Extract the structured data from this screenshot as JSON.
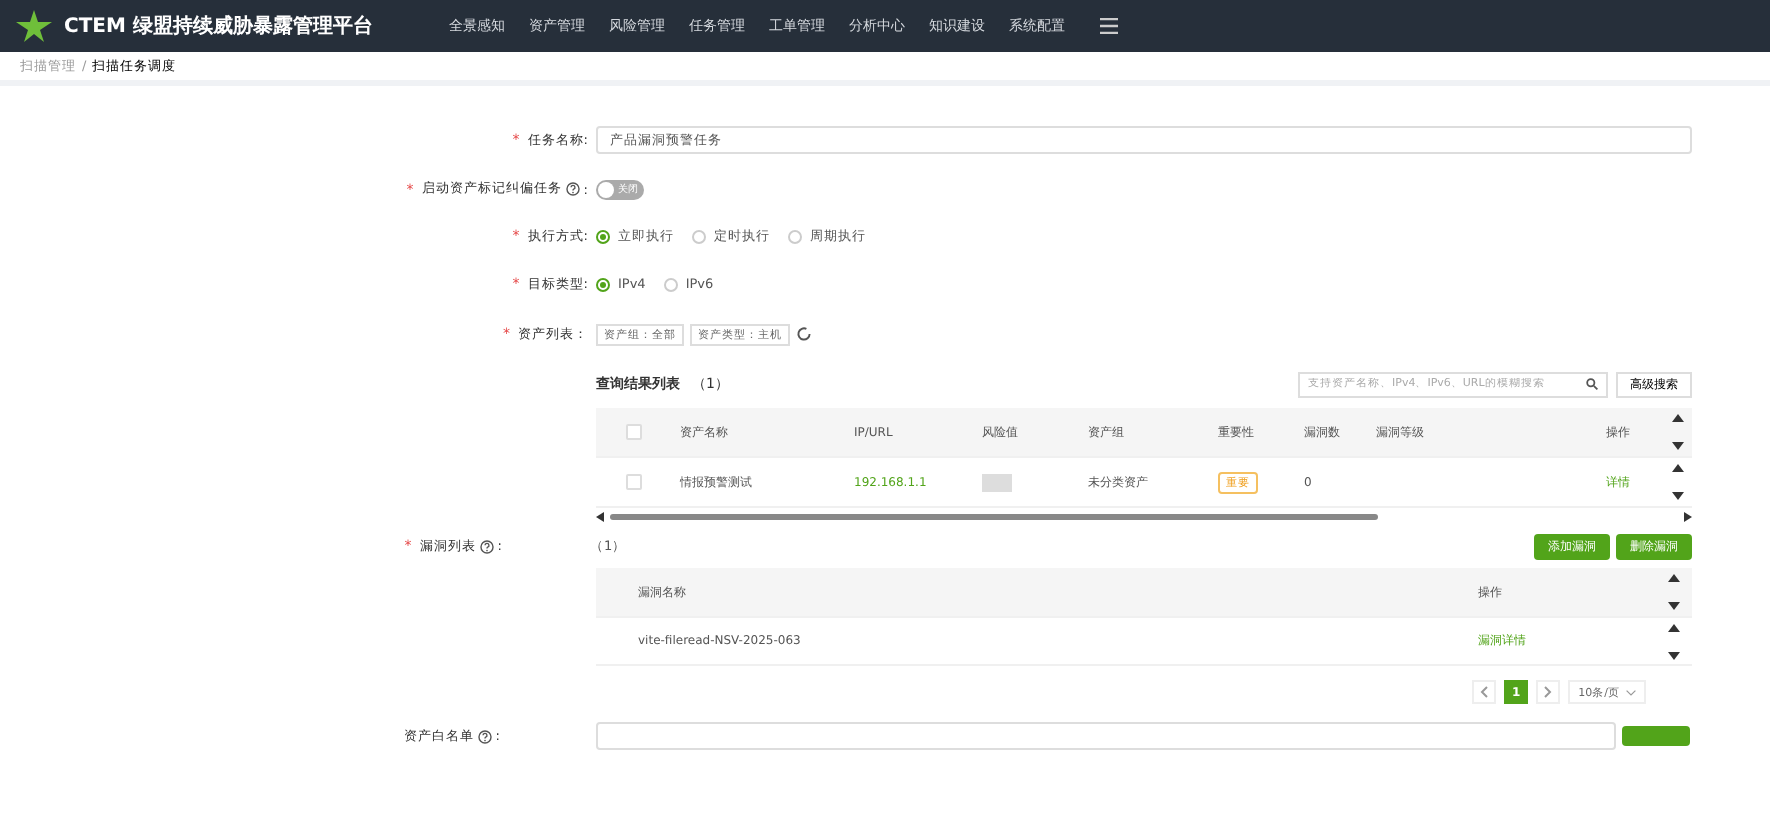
{
  "header": {
    "logo_text": "CTEM",
    "title": "绿盟持续威胁暴露管理平台",
    "nav": [
      "全景感知",
      "资产管理",
      "风险管理",
      "任务管理",
      "工单管理",
      "分析中心",
      "知识建设",
      "系统配置"
    ]
  },
  "breadcrumb": {
    "items": [
      "扫描管理",
      "扫描任务调度"
    ],
    "separator": "/"
  },
  "form": {
    "task_name": {
      "mark": "*",
      "label": "任务名称:",
      "value": "产品漏洞预警任务"
    },
    "asset_tag_task": {
      "mark": "*",
      "label": "启动资产标记纠偏任务",
      "colon": ":",
      "switch_text": "关闭",
      "on": false
    },
    "exec_mode": {
      "mark": "*",
      "label": "执行方式:",
      "options": [
        {
          "label": "立即执行",
          "selected": true
        },
        {
          "label": "定时执行",
          "selected": false
        },
        {
          "label": "周期执行",
          "selected": false
        }
      ]
    },
    "target_type": {
      "mark": "*",
      "label": "目标类型:",
      "options": [
        {
          "label": "IPv4",
          "selected": true
        },
        {
          "label": "IPv6",
          "selected": false
        }
      ]
    },
    "asset_list": {
      "mark": "*",
      "label": "资产列表：",
      "tags": [
        "资产组：全部",
        "资产类型：主机"
      ]
    },
    "results": {
      "title": "查询结果列表",
      "count": "（1）",
      "search_placeholder": "支持资产名称、IPv4、IPv6、URL的模糊搜索",
      "advanced_button": "高级搜索",
      "all_checked": false,
      "columns": [
        "资产名称",
        "IP/URL",
        "风险值",
        "资产组",
        "重要性",
        "漏洞数",
        "漏洞等级",
        "操作"
      ],
      "rows": [
        {
          "checked": false,
          "name": "情报预警测试",
          "ip": "192.168.1.1",
          "group": "未分类资产",
          "importance": "重要",
          "vuln_count": "0",
          "action": "详情"
        }
      ]
    },
    "vuln_list": {
      "mark": "*",
      "label": "漏洞列表",
      "colon": ":",
      "count": "（1）",
      "buttons": [
        "添加漏洞",
        "删除漏洞"
      ],
      "columns": [
        "漏洞名称",
        "操作"
      ],
      "rows": [
        {
          "name": "vite-fileread-NSV-2025-063",
          "action": "漏洞详情"
        }
      ]
    },
    "pagination": {
      "pages": [
        {
          "label": "1",
          "selected": true
        }
      ],
      "page_size": "10条/页"
    },
    "whitelist": {
      "label": "资产白名单",
      "colon": ":"
    }
  }
}
